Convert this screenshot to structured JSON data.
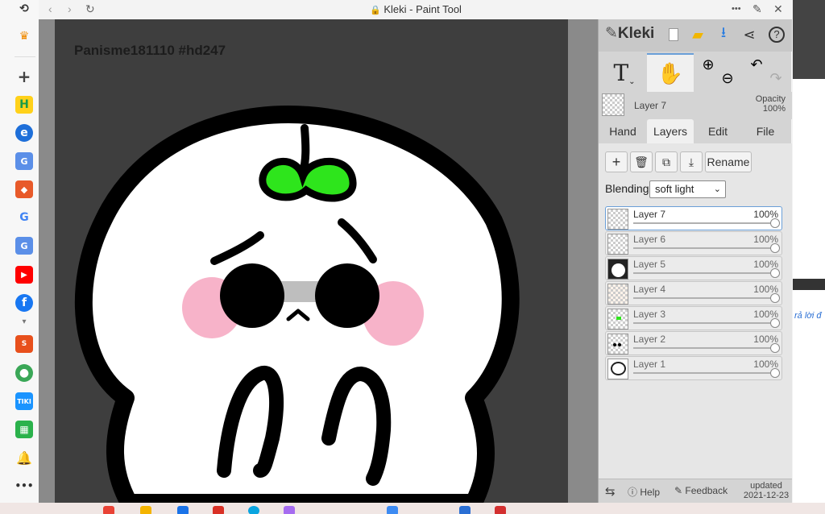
{
  "window": {
    "title": "Kleki - Paint Tool",
    "more_label": "•••"
  },
  "canvas": {
    "text": "Panisme181110 #hd247"
  },
  "panel": {
    "logo": "Kleki",
    "current_layer": {
      "name": "Layer 7",
      "opacity_label": "Opacity",
      "opacity_value": "100%"
    },
    "tabs": [
      {
        "label": "Hand",
        "active": false
      },
      {
        "label": "Layers",
        "active": true
      },
      {
        "label": "Edit",
        "active": false
      },
      {
        "label": "File",
        "active": false
      }
    ],
    "layer_buttons": {
      "rename": "Rename"
    },
    "blending": {
      "label": "Blending",
      "value": "soft light"
    },
    "layers": [
      {
        "name": "Layer 7",
        "opacity": "100%",
        "active": true
      },
      {
        "name": "Layer 6",
        "opacity": "100%",
        "active": false
      },
      {
        "name": "Layer 5",
        "opacity": "100%",
        "active": false
      },
      {
        "name": "Layer 4",
        "opacity": "100%",
        "active": false
      },
      {
        "name": "Layer 3",
        "opacity": "100%",
        "active": false
      },
      {
        "name": "Layer 2",
        "opacity": "100%",
        "active": false
      },
      {
        "name": "Layer 1",
        "opacity": "100%",
        "active": false
      }
    ],
    "footer": {
      "help": "Help",
      "feedback": "Feedback",
      "updated_label": "updated",
      "updated_date": "2021-12-23"
    }
  },
  "right_strip": {
    "text": "rả lời đ"
  },
  "colors": {
    "accent": "#6a9fd8",
    "leaf": "#2ee51c",
    "cheek": "#f7b3c9"
  }
}
